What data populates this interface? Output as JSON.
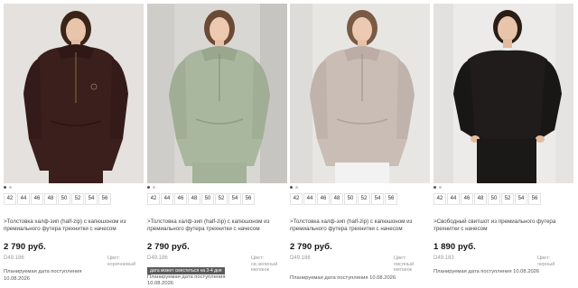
{
  "products": [
    {
      "name": ">Толстовка халф-зип (half-zip) с капюшоном из премиального футера трехнитки с начесом",
      "price": "2 790 руб.",
      "sku": "D49.186",
      "color_label": "Цвет:",
      "color_value": "коричневый",
      "badge": "",
      "plan_label": "Планируемая дата поступления",
      "plan_date": "10.08.2026",
      "sizes": [
        "42",
        "44",
        "46",
        "48",
        "50",
        "52",
        "54",
        "56"
      ],
      "garment_color": "#3b1f1c",
      "bg_color": "#e8e6e4"
    },
    {
      "name": ">Толстовка халф-зип (half-zip) с капюшоном из премиального футера трехнитки с начесом",
      "price": "2 790 руб.",
      "sku": "D49.186",
      "color_label": "Цвет:",
      "color_value": "св.зеленый меланж",
      "badge": "дата может сместиться на 3-4 дня",
      "plan_label": "Планируемая дата поступления",
      "plan_date": "10.08.2026",
      "sizes": [
        "42",
        "44",
        "46",
        "48",
        "50",
        "52",
        "54",
        "56"
      ],
      "garment_color": "#a8b79e",
      "bg_color": "#d9d8d4"
    },
    {
      "name": ">Толстовка халф-зип (half-zip) с капюшоном из премиального футера трехнитки с начесом",
      "price": "2 790 руб.",
      "sku": "D49.186",
      "color_label": "Цвет:",
      "color_value": "овсяный меланж",
      "badge": "",
      "plan_label": "Планируемая дата поступления 10.08.2026",
      "plan_date": "",
      "sizes": [
        "42",
        "44",
        "46",
        "48",
        "50",
        "52",
        "54",
        "56"
      ],
      "garment_color": "#c9bdb6",
      "bg_color": "#e7e5e3"
    },
    {
      "name": ">Свободный свитшот из премиального футера трехнитки с начесом",
      "price": "1 890 руб.",
      "sku": "D49.183",
      "color_label": "Цвет:",
      "color_value": "черный",
      "badge": "",
      "plan_label": "Планируемая дата поступления 10.08.2026",
      "plan_date": "",
      "sizes": [
        "42",
        "44",
        "46",
        "48",
        "50",
        "52",
        "54",
        "56"
      ],
      "garment_color": "#1f1c1b",
      "bg_color": "#ecebea"
    }
  ]
}
